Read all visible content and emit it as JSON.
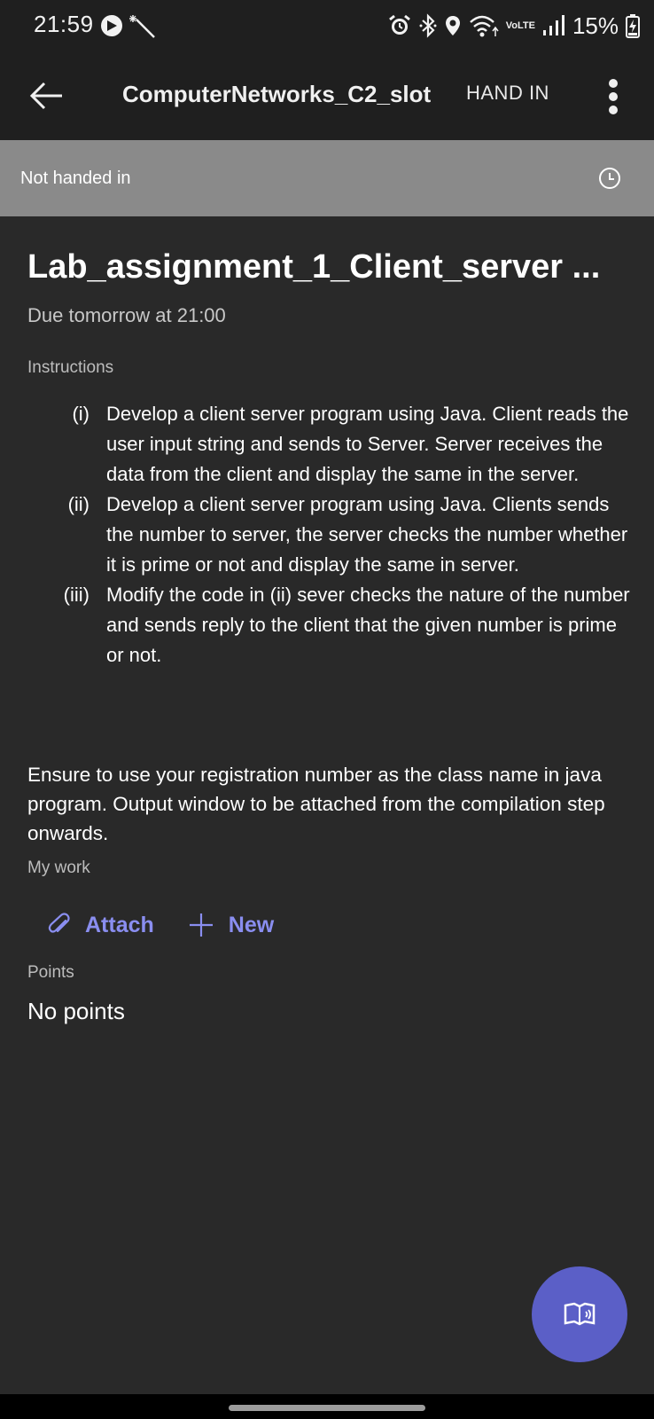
{
  "status_bar": {
    "time": "21:59",
    "network": "VoLTE",
    "battery": "15%",
    "icons": [
      "app-notification-icon",
      "magic-wand-icon",
      "alarm-icon",
      "bluetooth-icon",
      "location-icon",
      "wifi-icon",
      "signal-icon",
      "battery-charging-icon"
    ]
  },
  "app_bar": {
    "title": "ComputerNetworks_C2_slot",
    "hand_in_label": "HAND IN",
    "icons": [
      "back-arrow-icon",
      "more-vertical-icon"
    ]
  },
  "banner": {
    "status_text": "Not handed in",
    "icon": "clock-icon"
  },
  "assignment": {
    "title": "Lab_assignment_1_Client_server ...",
    "due": "Due tomorrow at 21:00",
    "instructions_label": "Instructions",
    "instructions": [
      {
        "num": "(i)",
        "text": "Develop a client server program using Java. Client reads the user input string and sends to Server. Server receives the data from the client and display the same in the server."
      },
      {
        "num": "(ii)",
        "text": "Develop a client server program using Java. Clients sends the number to server, the server checks the number whether it is prime or not and display the same in server."
      },
      {
        "num": "(iii)",
        "text": "Modify the code in (ii) sever checks the nature of the number and sends reply to the client that the given number is prime or not."
      }
    ],
    "note": "Ensure to use your registration number as the class name in java program. Output window to be attached from the compilation step onwards.",
    "my_work_label": "My work",
    "attach_label": "Attach",
    "new_label": "New",
    "points_label": "Points",
    "points_value": "No points"
  },
  "fab": {
    "icon": "immersive-reader-icon"
  },
  "colors": {
    "background": "#292929",
    "appbar": "#1f1f1f",
    "banner": "#8a8a8a",
    "accent": "#5b5fc7",
    "link": "#8a8ef0"
  }
}
